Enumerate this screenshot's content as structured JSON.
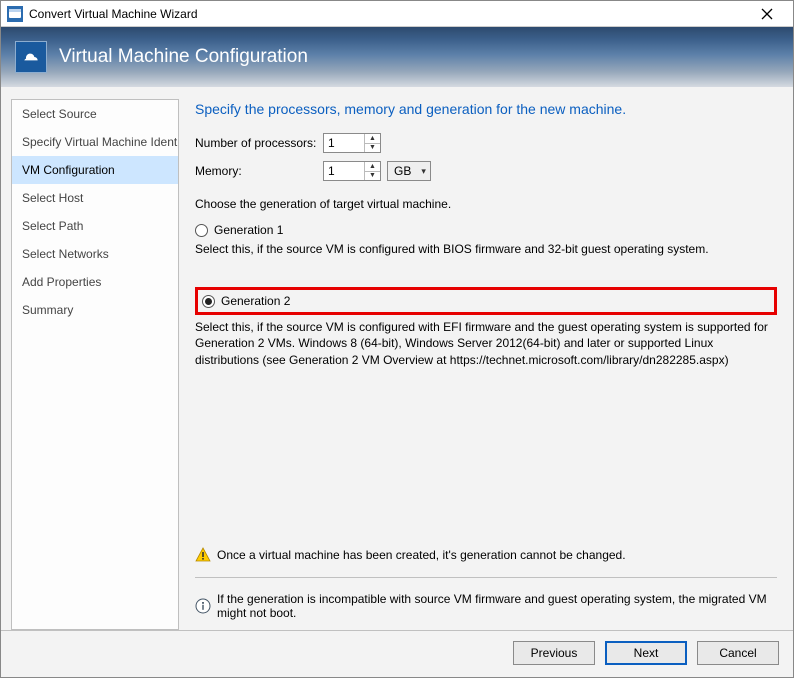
{
  "window": {
    "title": "Convert Virtual Machine Wizard"
  },
  "header": {
    "title": "Virtual Machine Configuration"
  },
  "sidebar": {
    "steps": [
      "Select Source",
      "Specify Virtual Machine Identity",
      "VM Configuration",
      "Select Host",
      "Select Path",
      "Select Networks",
      "Add Properties",
      "Summary"
    ],
    "active_index": 2
  },
  "page": {
    "heading": "Specify the processors, memory and generation for the new machine.",
    "processors_label": "Number of processors:",
    "processors_value": "1",
    "memory_label": "Memory:",
    "memory_value": "1",
    "memory_unit": "GB",
    "generation_prompt": "Choose the generation of target virtual machine.",
    "gen1": {
      "label": "Generation 1",
      "checked": false,
      "desc": "Select this, if the source VM is configured with BIOS firmware and 32-bit guest operating system."
    },
    "gen2": {
      "label": "Generation 2",
      "checked": true,
      "desc": "Select this, if the source VM is configured with EFI firmware and the guest operating system is supported for Generation 2 VMs. Windows 8 (64-bit), Windows Server 2012(64-bit) and later or supported Linux distributions (see Generation 2 VM Overview at https://technet.microsoft.com/library/dn282285.aspx)"
    },
    "warning": "Once a virtual machine has been created, it's generation cannot be changed.",
    "info": "If the generation is incompatible with source VM firmware and guest operating system, the migrated VM might not boot."
  },
  "footer": {
    "previous": "Previous",
    "next": "Next",
    "cancel": "Cancel"
  }
}
